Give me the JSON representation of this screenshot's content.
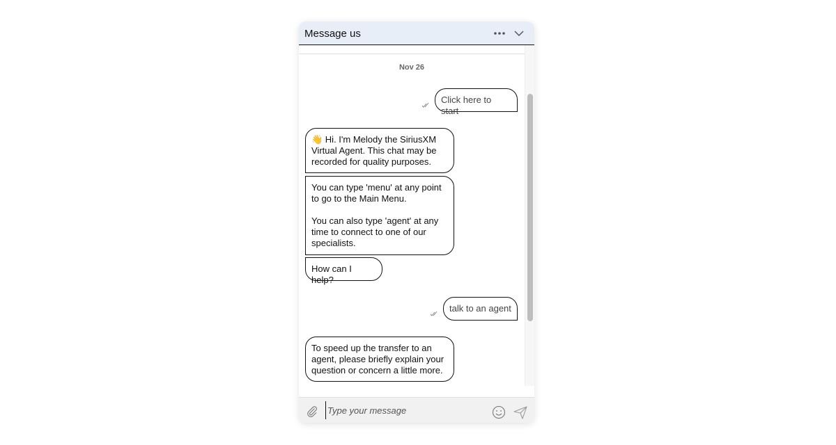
{
  "header": {
    "title": "Message us",
    "more_icon": "more-horizontal-icon",
    "collapse_icon": "chevron-down-icon"
  },
  "chat": {
    "date": "Nov 26",
    "messages": [
      {
        "sender": "user",
        "text": "Click here to start",
        "status": "read"
      },
      {
        "sender": "bot",
        "text": "👋 Hi. I'm Melody the SiriusXM Virtual Agent. This chat may be recorded for quality purposes."
      },
      {
        "sender": "bot",
        "text": "You can type 'menu' at any point to go to the Main Menu.\n\nYou can also type 'agent' at any time to connect to one of our specialists."
      },
      {
        "sender": "bot",
        "text": "How can I help?"
      },
      {
        "sender": "user",
        "text": "talk to an agent",
        "status": "read"
      },
      {
        "sender": "bot",
        "text": "To speed up the transfer to an agent, please briefly explain your question or concern a little more."
      }
    ]
  },
  "composer": {
    "placeholder": "Type your message",
    "value": "",
    "attach_icon": "paperclip-icon",
    "emoji_icon": "smiley-icon",
    "send_icon": "send-icon"
  }
}
